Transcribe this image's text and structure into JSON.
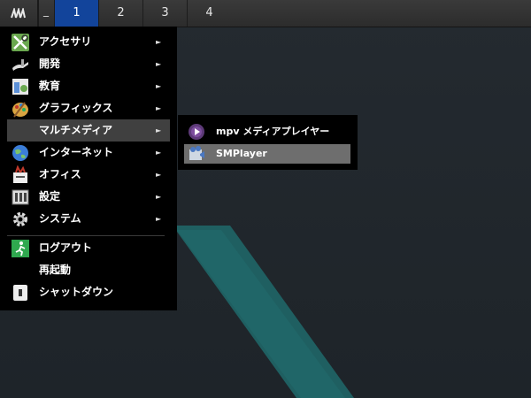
{
  "panel": {
    "show_desktop_label": "_",
    "workspaces": [
      "1",
      "2",
      "3",
      "4"
    ],
    "active_workspace": "1"
  },
  "menu": {
    "items": [
      {
        "label": "アクセサリ",
        "icon": "accessories-icon"
      },
      {
        "label": "開発",
        "icon": "development-icon"
      },
      {
        "label": "教育",
        "icon": "education-icon"
      },
      {
        "label": "グラフィックス",
        "icon": "graphics-icon"
      },
      {
        "label": "マルチメディア",
        "icon": "multimedia-icon"
      },
      {
        "label": "インターネット",
        "icon": "internet-icon"
      },
      {
        "label": "オフィス",
        "icon": "office-icon"
      },
      {
        "label": "設定",
        "icon": "settings-icon"
      },
      {
        "label": "システム",
        "icon": "system-icon"
      }
    ],
    "actions": [
      {
        "label": "ログアウト",
        "icon": "logout-icon"
      },
      {
        "label": "再起動",
        "icon": ""
      },
      {
        "label": "シャットダウン",
        "icon": "shutdown-icon"
      }
    ],
    "highlighted": "マルチメディア",
    "arrow": "►"
  },
  "submenu": {
    "items": [
      {
        "label": "mpv メディアプレイヤー",
        "icon": "mpv-icon"
      },
      {
        "label": "SMPlayer",
        "icon": "smplayer-icon"
      }
    ],
    "highlighted": "SMPlayer"
  }
}
